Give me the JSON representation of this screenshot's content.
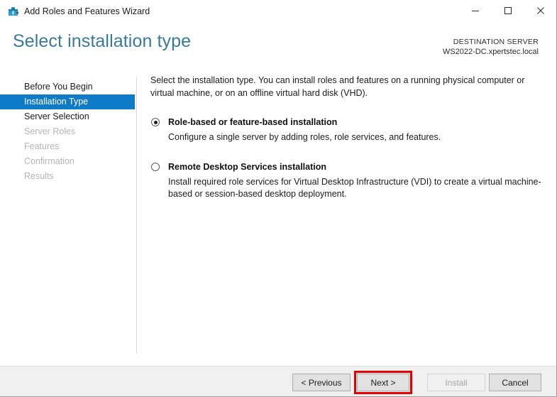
{
  "window": {
    "title": "Add Roles and Features Wizard",
    "icon": "wizard-toolbox-icon",
    "controls": {
      "minimize": "minimize-icon",
      "maximize": "maximize-icon",
      "close": "close-icon"
    }
  },
  "header": {
    "page_title": "Select installation type",
    "destination_label": "DESTINATION SERVER",
    "destination_server": "WS2022-DC.xpertstec.local",
    "title_color": "#3a7a99"
  },
  "sidebar": {
    "accent_color": "#0f7ac7",
    "items": [
      {
        "label": "Before You Begin",
        "state": "enabled"
      },
      {
        "label": "Installation Type",
        "state": "active"
      },
      {
        "label": "Server Selection",
        "state": "enabled"
      },
      {
        "label": "Server Roles",
        "state": "disabled"
      },
      {
        "label": "Features",
        "state": "disabled"
      },
      {
        "label": "Confirmation",
        "state": "disabled"
      },
      {
        "label": "Results",
        "state": "disabled"
      }
    ]
  },
  "main": {
    "intro": "Select the installation type. You can install roles and features on a running physical computer or virtual machine, or on an offline virtual hard disk (VHD).",
    "options": [
      {
        "title": "Role-based or feature-based installation",
        "description": "Configure a single server by adding roles, role services, and features.",
        "selected": true
      },
      {
        "title": "Remote Desktop Services installation",
        "description": "Install required role services for Virtual Desktop Infrastructure (VDI) to create a virtual machine-based or session-based desktop deployment.",
        "selected": false
      }
    ]
  },
  "footer": {
    "previous_label": "< Previous",
    "next_label": "Next >",
    "install_label": "Install",
    "cancel_label": "Cancel",
    "install_disabled": true,
    "highlight_color": "#e50000",
    "highlighted_button": "next-button"
  }
}
